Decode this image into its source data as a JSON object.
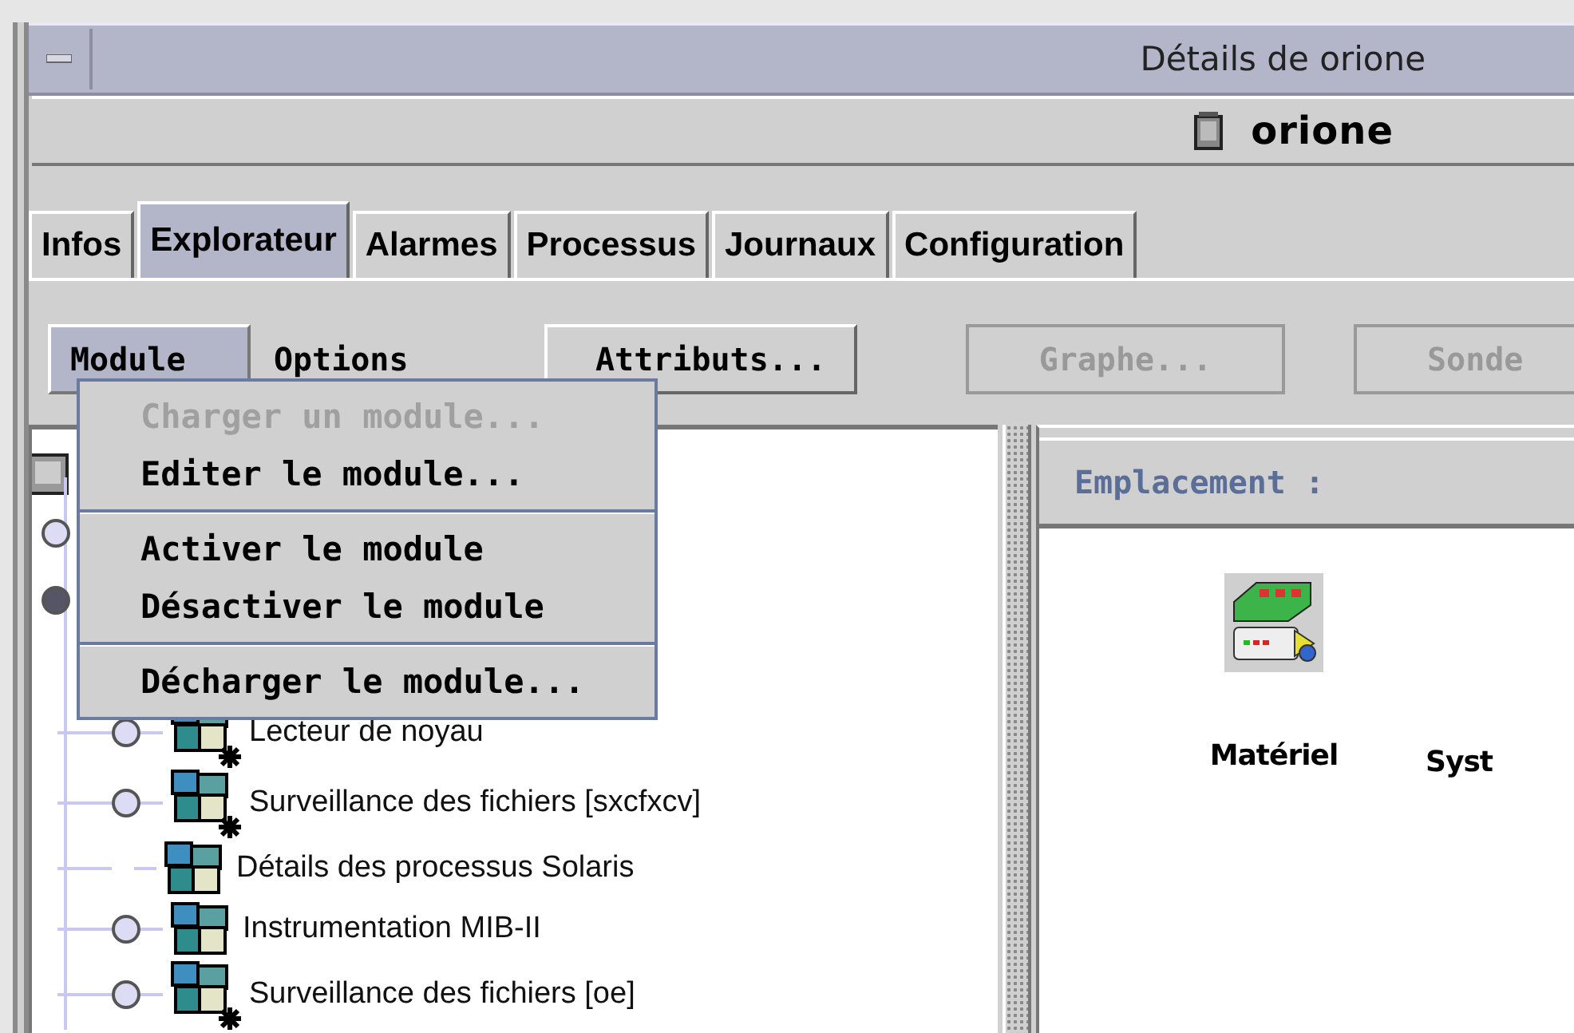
{
  "window": {
    "title": "Détails de orione"
  },
  "host": {
    "name": "orione"
  },
  "tabs": [
    {
      "label": "Infos",
      "selected": false
    },
    {
      "label": "Explorateur",
      "selected": true
    },
    {
      "label": "Alarmes",
      "selected": false
    },
    {
      "label": "Processus",
      "selected": false
    },
    {
      "label": "Journaux",
      "selected": false
    },
    {
      "label": "Configuration",
      "selected": false
    }
  ],
  "menubar": [
    {
      "label": "Module",
      "selected": true
    },
    {
      "label": "Options",
      "selected": false
    }
  ],
  "toolbar": [
    {
      "label": "Attributs...",
      "disabled": false
    },
    {
      "label": "Graphe...",
      "disabled": true
    },
    {
      "label": "Sonde",
      "disabled": true
    }
  ],
  "menu": [
    {
      "kind": "item",
      "label": "Charger un module...",
      "disabled": true
    },
    {
      "kind": "item",
      "label": "Editer le module...",
      "disabled": false
    },
    {
      "kind": "separator"
    },
    {
      "kind": "item",
      "label": "Activer le module",
      "disabled": false
    },
    {
      "kind": "item",
      "label": "Désactiver le module",
      "disabled": false
    },
    {
      "kind": "separator"
    },
    {
      "kind": "item",
      "label": "Décharger le module...",
      "disabled": false
    }
  ],
  "tree": {
    "nodes": [
      {
        "expanded": false
      },
      {
        "expanded": true,
        "children": [
          {
            "label": "Lecteur de noyau",
            "expandable": true,
            "badge": true
          },
          {
            "label": "Surveillance des fichiers [sxcfxcv]",
            "expandable": true,
            "badge": true
          },
          {
            "label": "Détails des processus Solaris",
            "expandable": false,
            "badge": false
          },
          {
            "label": "Instrumentation MIB-II",
            "expandable": true,
            "badge": false
          },
          {
            "label": "Surveillance des fichiers [oe]",
            "expandable": true,
            "badge": true
          }
        ]
      }
    ]
  },
  "location": {
    "label": "Emplacement :"
  },
  "items": [
    {
      "kind": "hardware",
      "label": "Matériel"
    },
    {
      "kind": "system",
      "label": "Syst"
    }
  ]
}
